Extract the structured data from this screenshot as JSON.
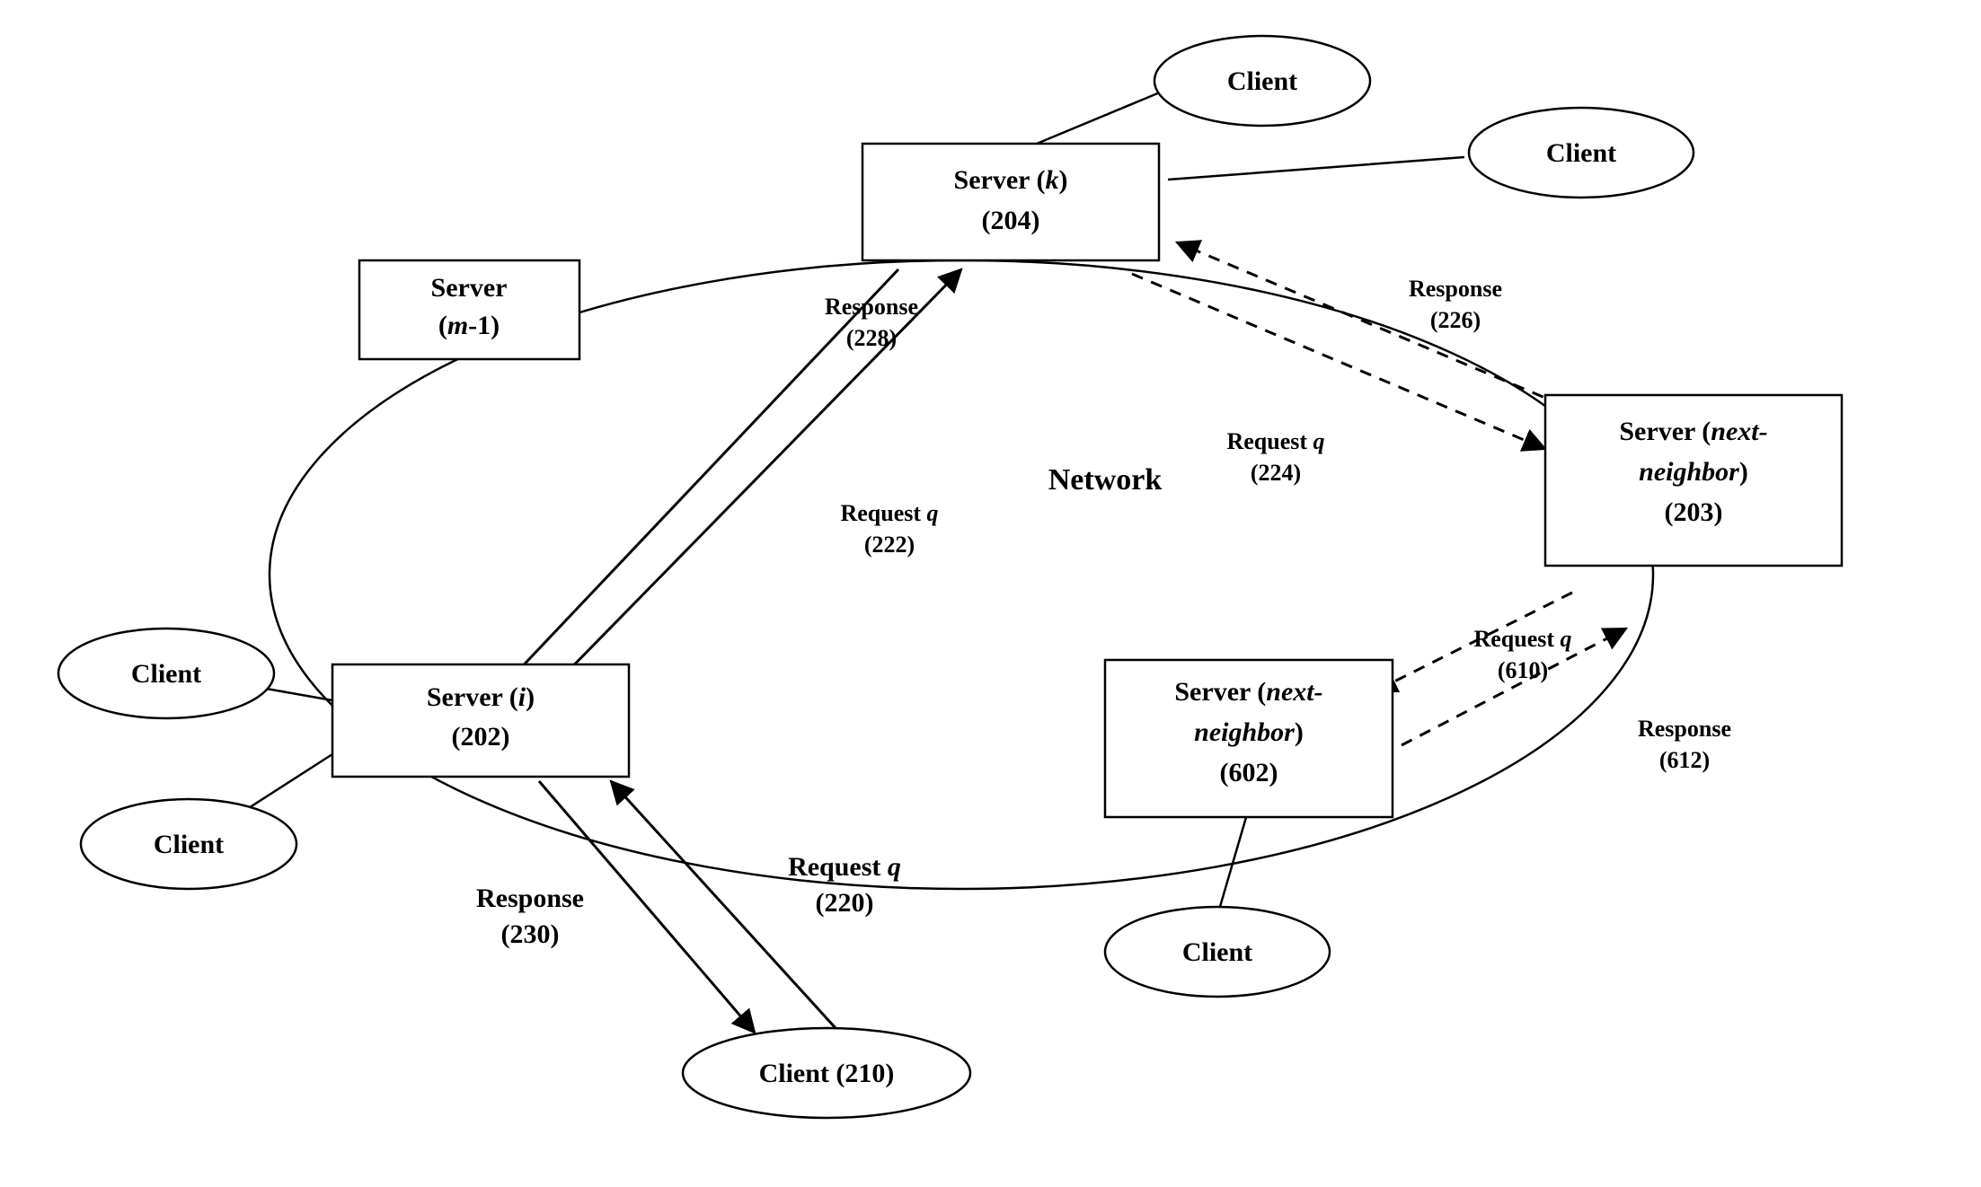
{
  "nodes": {
    "server_m1": {
      "line1_a": "Server",
      "line2": "(",
      "line2_i": "m",
      "line2_b": "-1)"
    },
    "server_k": {
      "line1_a": "Server  (",
      "line1_i": "k",
      "line1_b": ")",
      "line2": "(204)"
    },
    "server_i": {
      "line1_a": "Server (",
      "line1_i": "i",
      "line1_b": ")",
      "line2": "(202)"
    },
    "server_203": {
      "line1_a": "Server (",
      "line1_i": "next-",
      "line2_i": "neighbor",
      "line2_b": ")",
      "line3": "(203)"
    },
    "server_602": {
      "line1_a": "Server (",
      "line1_i": "next-",
      "line2_i": "neighbor",
      "line2_b": ")",
      "line3": "(602)"
    },
    "client_label": "Client",
    "client_210": "Client (210)",
    "network": "Network"
  },
  "labels": {
    "resp_228": {
      "t1": "Response",
      "t2": "(228)"
    },
    "req_222": {
      "t1_a": "Request ",
      "t1_i": "q",
      "t2": "(222)"
    },
    "req_224": {
      "t1_a": "Request ",
      "t1_i": "q",
      "t2": "(224)"
    },
    "resp_226": {
      "t1": "Response",
      "t2": "(226)"
    },
    "req_610": {
      "t1_a": "Request ",
      "t1_i": "q",
      "t2": "(610)"
    },
    "resp_612": {
      "t1": "Response",
      "t2": "(612)"
    },
    "req_220": {
      "t1_a": "Request ",
      "t1_i": "q",
      "t2": "(220)"
    },
    "resp_230": {
      "t1": "Response",
      "t2": "(230)"
    }
  }
}
